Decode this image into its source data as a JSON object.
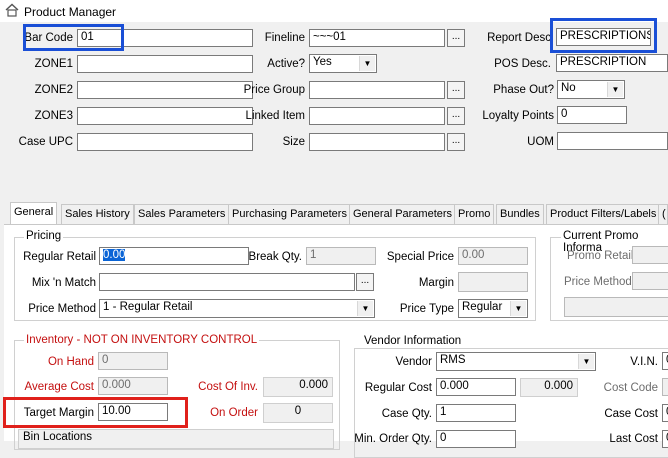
{
  "window": {
    "title": "Product Manager",
    "icon": "house-icon"
  },
  "header": {
    "bar_code_label": "Bar Code",
    "bar_code_value": "01",
    "zone1_label": "ZONE1",
    "zone2_label": "ZONE2",
    "zone3_label": "ZONE3",
    "case_upc_label": "Case UPC",
    "fineline_label": "Fineline",
    "fineline_value": "~~~01",
    "active_label": "Active?",
    "active_value": "Yes",
    "price_group_label": "Price Group",
    "linked_item_label": "Linked Item",
    "size_label": "Size",
    "report_desc_label": "Report Desc",
    "report_desc_value": "PRESCRIPTIONS",
    "pos_desc_label": "POS Desc.",
    "pos_desc_value": "PRESCRIPTION",
    "phase_out_label": "Phase Out?",
    "phase_out_value": "No",
    "loyalty_points_label": "Loyalty Points",
    "loyalty_points_value": "0",
    "uom_label": "UOM",
    "ellipsis": "..."
  },
  "tabs": [
    "General",
    "Sales History",
    "Sales Parameters",
    "Purchasing Parameters",
    "General Parameters",
    "Promo",
    "Bundles",
    "Product Filters/Labels",
    "("
  ],
  "pricing": {
    "title": "Pricing",
    "regular_retail_label": "Regular Retail",
    "regular_retail_value": "0.00",
    "break_qty_label": "Break Qty.",
    "break_qty_value": "1",
    "special_price_label": "Special Price",
    "special_price_value": "0.00",
    "mix_match_label": "Mix 'n Match",
    "margin_label": "Margin",
    "price_method_label": "Price Method",
    "price_method_value": "1 - Regular Retail",
    "price_type_label": "Price Type",
    "price_type_value": "Regular"
  },
  "current_promo": {
    "title": "Current Promo Informa",
    "promo_retail_label": "Promo Retail",
    "price_method_label": "Price Method"
  },
  "inventory": {
    "title": "Inventory - NOT ON INVENTORY CONTROL",
    "on_hand_label": "On Hand",
    "on_hand_value": "0",
    "average_cost_label": "Average Cost",
    "average_cost_value": "0.000",
    "cost_of_inv_label": "Cost Of Inv.",
    "cost_of_inv_value": "0.000",
    "target_margin_label": "Target Margin",
    "target_margin_value": "10.00",
    "on_order_label": "On Order",
    "on_order_value": "0",
    "bin_locations_label": "Bin Locations"
  },
  "vendor": {
    "title": "Vendor Information",
    "vendor_label": "Vendor",
    "vendor_value": "RMS",
    "vin_label": "V.I.N.",
    "vin_value": "0",
    "regular_cost_label": "Regular Cost",
    "regular_cost_value": "0.000",
    "regular_cost_value2": "0.000",
    "cost_code_label": "Cost Code",
    "case_qty_label": "Case Qty.",
    "case_qty_value": "1",
    "case_cost_label": "Case Cost",
    "case_cost_value": "0",
    "min_order_qty_label": "Min. Order Qty.",
    "min_order_qty_value": "0",
    "last_cost_label": "Last Cost",
    "last_cost_value": "0"
  }
}
